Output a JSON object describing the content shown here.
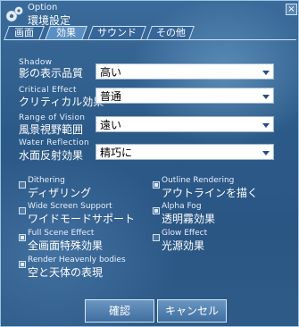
{
  "window": {
    "title_en": "Option",
    "title_jp": "環境設定",
    "close_symbol": "×"
  },
  "tabs": [
    {
      "label": "画面",
      "active": false
    },
    {
      "label": "効果",
      "active": true
    },
    {
      "label": "サウンド",
      "active": false
    },
    {
      "label": "その他",
      "active": false
    }
  ],
  "settings": [
    {
      "label_en": "Shadow",
      "label_jp": "影の表示品質",
      "value": "高い"
    },
    {
      "label_en": "Critical Effect",
      "label_jp": "クリティカル効果",
      "value": "普通"
    },
    {
      "label_en": "Range of Vision",
      "label_jp": "風景視野範囲",
      "value": "遠い"
    },
    {
      "label_en": "Water Reflection",
      "label_jp": "水面反射効果",
      "value": "精巧に"
    }
  ],
  "checkboxes": [
    {
      "label_en": "Dithering",
      "label_jp": "ディザリング",
      "checked": false
    },
    {
      "label_en": "Outline Rendering",
      "label_jp": "アウトラインを描く",
      "checked": true
    },
    {
      "label_en": "Wide Screen Support",
      "label_jp": "ワイドモードサポート",
      "checked": false
    },
    {
      "label_en": "Alpha Fog",
      "label_jp": "透明霧効果",
      "checked": true
    },
    {
      "label_en": "Full Scene Effect",
      "label_jp": "全画面特殊効果",
      "checked": true
    },
    {
      "label_en": "Glow Effect",
      "label_jp": "光源効果",
      "checked": false
    },
    {
      "label_en": "Render Heavenly bodies",
      "label_jp": "空と天体の表現",
      "checked": true
    }
  ],
  "buttons": {
    "confirm": "確認",
    "cancel": "キャンセル"
  }
}
